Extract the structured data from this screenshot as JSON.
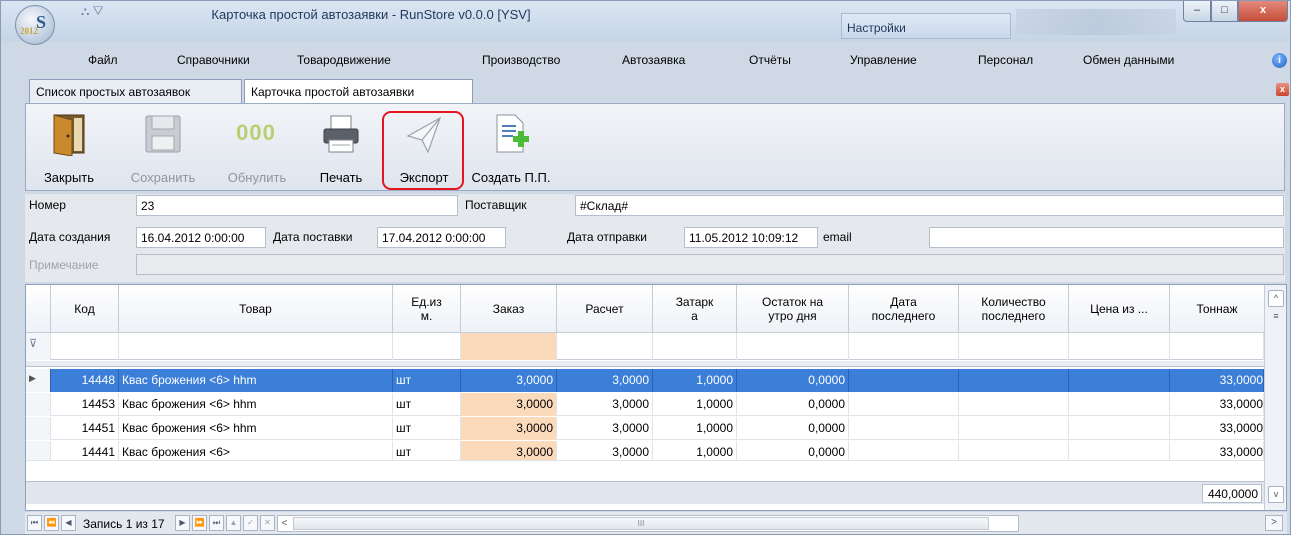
{
  "window": {
    "title": "Карточка простой автозаявки - RunStore v0.0.0 [YSV]",
    "context_tab": "Настройки",
    "logo_text": "S",
    "logo_year": "2012",
    "qat_glyphs": "⛬  ▽",
    "minimize": "–",
    "maximize": "□",
    "close": "x"
  },
  "menu": {
    "items": [
      "Файл",
      "Справочники",
      "Товародвижение",
      "Производство",
      "Автозаявка",
      "Отчёты",
      "Управление",
      "Персонал",
      "Обмен данными"
    ],
    "help": "i"
  },
  "doc_tabs": {
    "items": [
      "Список простых автозаявок",
      "Карточка простой автозаявки"
    ],
    "active_index": 1,
    "close": "x"
  },
  "ribbon": {
    "buttons": [
      {
        "label": "Закрыть",
        "icon": "door-icon",
        "enabled": true
      },
      {
        "label": "Сохранить",
        "icon": "save-icon",
        "enabled": false
      },
      {
        "label": "Обнулить",
        "icon": "reset-icon",
        "enabled": false,
        "glyph": "000"
      },
      {
        "label": "Печать",
        "icon": "printer-icon",
        "enabled": true
      },
      {
        "label": "Экспорт",
        "icon": "paper-plane-icon",
        "enabled": true,
        "highlighted": true
      },
      {
        "label": "Создать П.П.",
        "icon": "document-add-icon",
        "enabled": true
      }
    ]
  },
  "form": {
    "number_label": "Номер",
    "number_value": "23",
    "supplier_label": "Поставщик",
    "supplier_value": "#Склад#",
    "created_label": "Дата создания",
    "created_value": "16.04.2012 0:00:00",
    "delivery_label": "Дата поставки",
    "delivery_value": "17.04.2012 0:00:00",
    "sent_label": "Дата отправки",
    "sent_value": "11.05.2012 10:09:12",
    "email_label": "email",
    "email_value": "",
    "note_label": "Примечание",
    "note_value": ""
  },
  "grid": {
    "columns": [
      "Код",
      "Товар",
      "Ед.из\nм.",
      "Заказ",
      "Расчет",
      "Затарк\nа",
      "Остаток на\nутро дня",
      "Дата\nпоследнего",
      "Количество\nпоследнего",
      "Цена из ...",
      "Тоннаж"
    ],
    "filter_glyph": "⊽",
    "rows": [
      {
        "code": "14448",
        "product": "Квас брожения  <6> hhm",
        "unit": "шт",
        "order": "3,0000",
        "calc": "3,0000",
        "pack": "1,0000",
        "stock": "0,0000",
        "last_date": "",
        "last_qty": "",
        "price": "",
        "tonnage": "33,0000",
        "selected": true
      },
      {
        "code": "14453",
        "product": "Квас брожения  <6> hhm",
        "unit": "шт",
        "order": "3,0000",
        "calc": "3,0000",
        "pack": "1,0000",
        "stock": "0,0000",
        "last_date": "",
        "last_qty": "",
        "price": "",
        "tonnage": "33,0000",
        "selected": false
      },
      {
        "code": "14451",
        "product": "Квас брожения  <6> hhm",
        "unit": "шт",
        "order": "3,0000",
        "calc": "3,0000",
        "pack": "1,0000",
        "stock": "0,0000",
        "last_date": "",
        "last_qty": "",
        "price": "",
        "tonnage": "33,0000",
        "selected": false
      },
      {
        "code": "14441",
        "product": "Квас брожения  <6>",
        "unit": "шт",
        "order": "3,0000",
        "calc": "3,0000",
        "pack": "1,0000",
        "stock": "0,0000",
        "last_date": "",
        "last_qty": "",
        "price": "",
        "tonnage": "33,0000",
        "selected": false
      }
    ],
    "total_tonnage": "440,0000",
    "scroll_up": "^",
    "scroll_down": "v",
    "scroll_grip": "≡"
  },
  "navigator": {
    "record_text": "Запись 1 из 17",
    "buttons_left": [
      "⏮",
      "⏪",
      "◀"
    ],
    "buttons_right": [
      "▶",
      "⏩",
      "⏭",
      "▲",
      "✓",
      "✕",
      "<"
    ],
    "scroll_grip": "III",
    "scroll_right": ">"
  }
}
